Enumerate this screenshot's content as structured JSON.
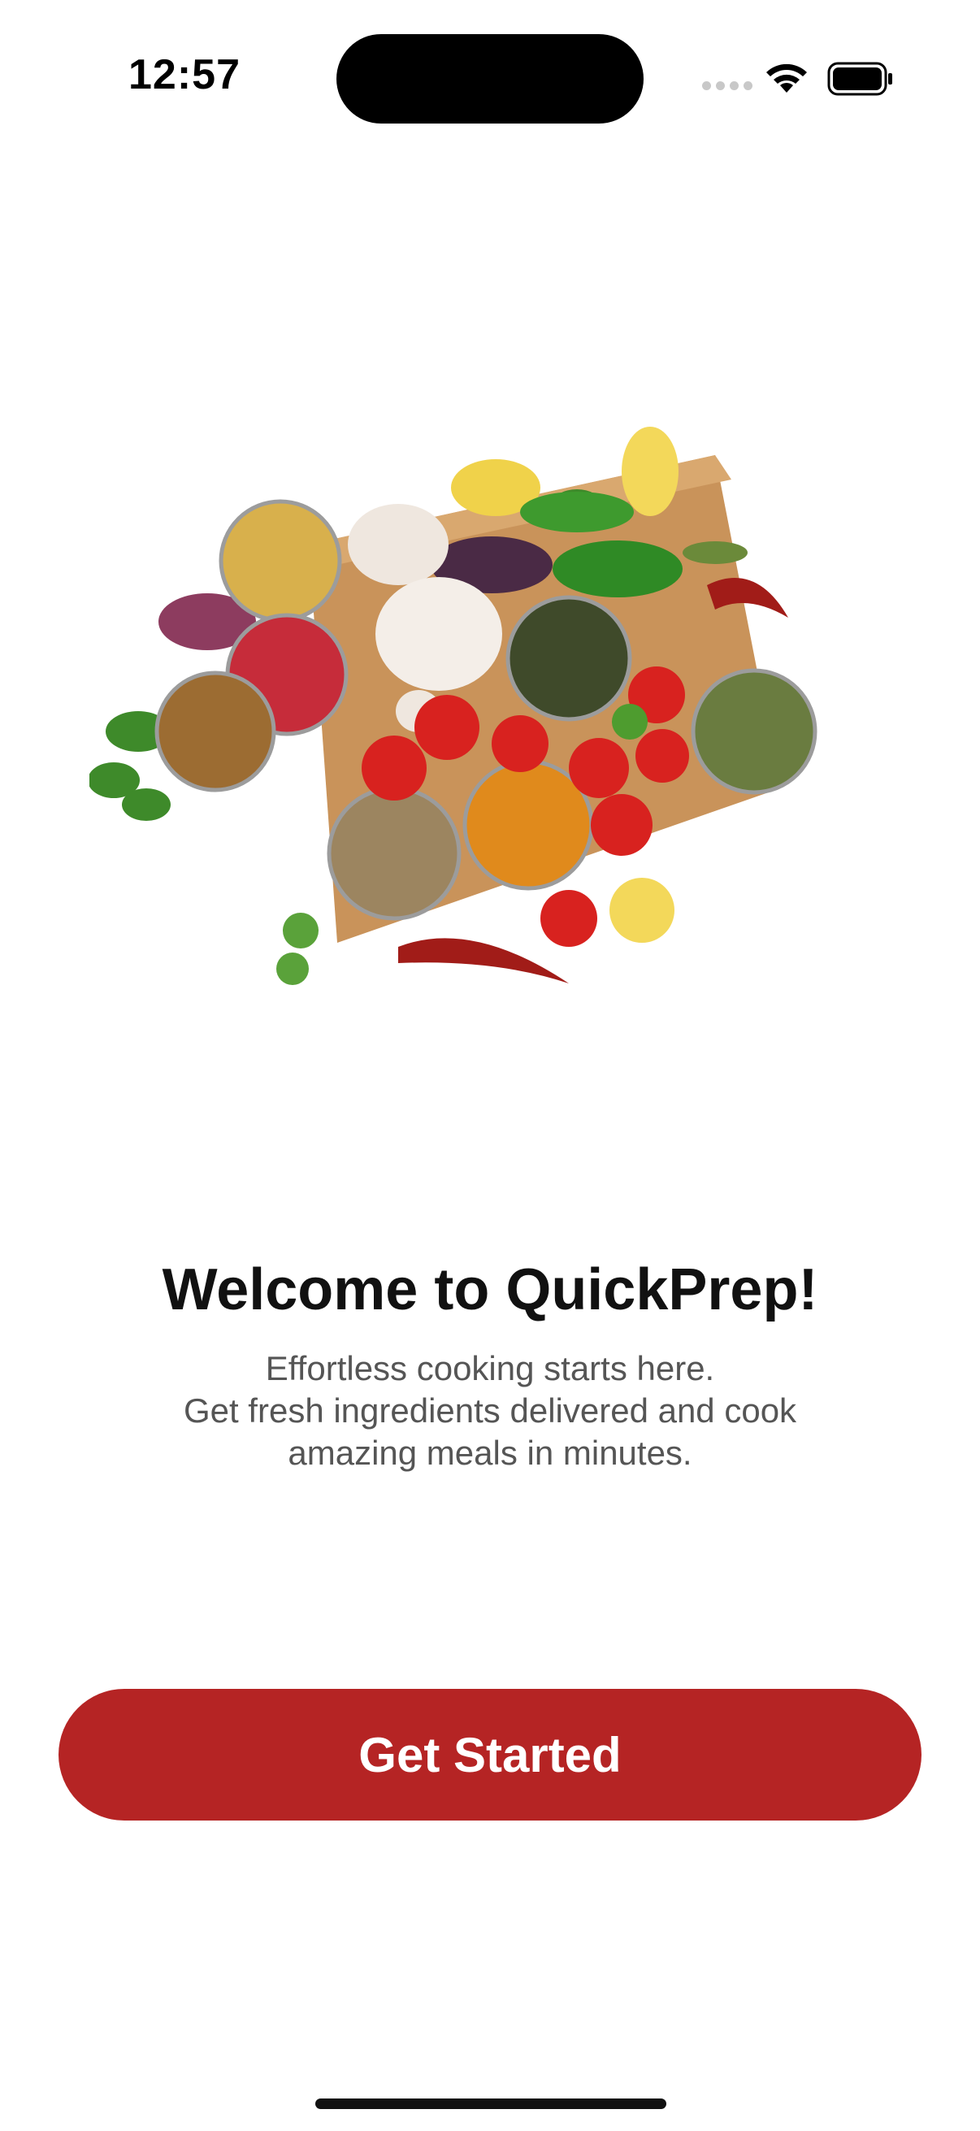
{
  "status": {
    "time": "12:57",
    "icons": [
      "signal-icon",
      "wifi-icon",
      "battery-icon"
    ]
  },
  "hero": {
    "icon": "ingredients-cutting-board-illustration"
  },
  "welcome": {
    "title": "Welcome to QuickPrep!",
    "lines": [
      "Effortless cooking starts here.",
      "Get fresh ingredients delivered and cook",
      "amazing meals in minutes."
    ]
  },
  "actions": {
    "get_started_label": "Get Started"
  },
  "colors": {
    "accent": "#b52424",
    "title": "#111111",
    "subtitle": "#555555",
    "background": "#ffffff"
  }
}
